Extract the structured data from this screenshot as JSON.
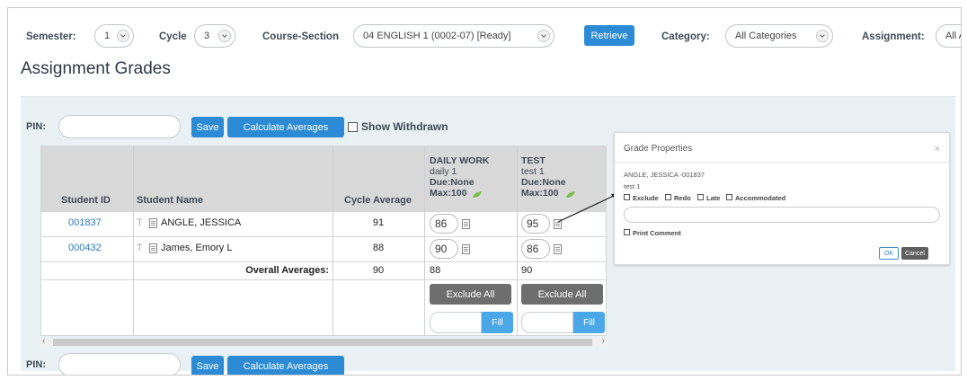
{
  "filters": {
    "semester_label": "Semester:",
    "semester_value": "1",
    "cycle_label": "Cycle",
    "cycle_value": "3",
    "course_section_label": "Course-Section",
    "course_section_value": "04 ENGLISH 1 (0002-07) [Ready]",
    "retrieve_label": "Retrieve",
    "category_label": "Category:",
    "category_value": "All Categories",
    "assignment_label": "Assignment:",
    "assignment_value": "All A"
  },
  "page_title": "Assignment Grades",
  "toolbar": {
    "pin_label": "PIN:",
    "save_label": "Save",
    "calc_label": "Calculate Averages",
    "show_withdrawn_label": "Show Withdrawn"
  },
  "table": {
    "headers": {
      "student_id": "Student ID",
      "student_name": "Student Name",
      "cycle_average": "Cycle Average"
    },
    "assignments": [
      {
        "category": "DAILY WORK",
        "name": "daily 1",
        "due": "Due:None",
        "max": "Max:100"
      },
      {
        "category": "TEST",
        "name": "test 1",
        "due": "Due:None",
        "max": "Max:100"
      }
    ],
    "rows": [
      {
        "id": "001837",
        "t": "T",
        "name": "ANGLE, JESSICA",
        "avg": "91",
        "grades": [
          "86",
          "95"
        ]
      },
      {
        "id": "000432",
        "t": "T",
        "name": "James, Emory L",
        "avg": "88",
        "grades": [
          "90",
          "86"
        ]
      }
    ],
    "overall_label": "Overall Averages:",
    "overall_avg": "90",
    "overall_grades": [
      "88",
      "90"
    ],
    "exclude_all_label": "Exclude All",
    "fill_label": "Fill"
  },
  "bottom_toolbar": {
    "pin_label": "PIN:",
    "save_label": "Save",
    "calc_label": "Calculate Averages"
  },
  "dialog": {
    "title": "Grade Properties",
    "close": "×",
    "student": "ANGLE, JESSICA -001837",
    "assignment": "test 1",
    "exclude_label": "Exclude",
    "redo_label": "Redo",
    "late_label": "Late",
    "accommodated_label": "Accommodated",
    "print_comment_label": "Print Comment",
    "ok_label": "OK",
    "cancel_label": "Cancel"
  },
  "colors": {
    "accent": "#2d8bd6",
    "panel_bg": "#e9f1f4",
    "header_bg": "#d9d9d9",
    "gray_button": "#6e6e6e"
  }
}
